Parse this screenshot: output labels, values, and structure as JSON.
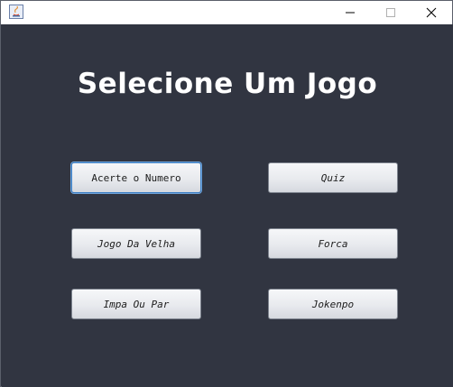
{
  "window": {
    "controls": {
      "minimize_icon": "minimize-icon",
      "maximize_icon": "maximize-icon",
      "close_icon": "close-icon"
    }
  },
  "main": {
    "title": "Selecione Um Jogo",
    "buttons": [
      {
        "label": "Acerte o Numero",
        "focused": true
      },
      {
        "label": "Quiz"
      },
      {
        "label": "Jogo Da Velha"
      },
      {
        "label": "Forca"
      },
      {
        "label": "Impa Ou Par"
      },
      {
        "label": "Jokenpo"
      }
    ]
  },
  "colors": {
    "background": "#313541",
    "title_text": "#ffffff",
    "focus_ring": "#3d7fc4"
  }
}
